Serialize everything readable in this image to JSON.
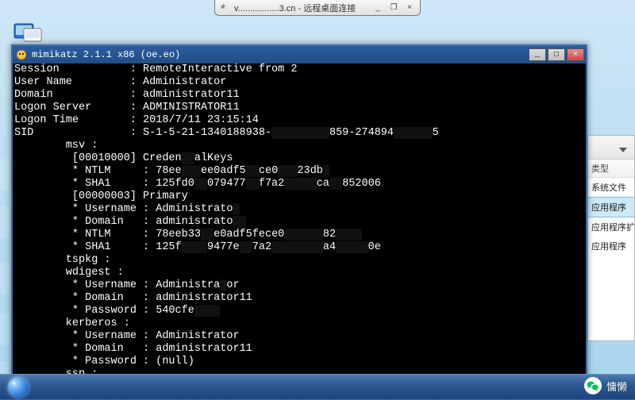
{
  "rdp": {
    "host_partial": "v.................3.cn",
    "suffix": " - 远程桌面连接"
  },
  "console": {
    "title": "mimikatz 2.1.1 x86 (oe.eo)",
    "lines": [
      {
        "t": "Session           : RemoteInteractive from 2"
      },
      {
        "t": "User Name         : Administrator"
      },
      {
        "t": "Domain            : administrator11"
      },
      {
        "t": "Logon Server      : ADMINISTRATOR11"
      },
      {
        "t": "Logon Time        : 2018/7/11 23:15:14"
      },
      {
        "t": "SID               : S-1-5-21-1340188938-",
        "b": "         ",
        "t2": "859-274894",
        "b2": "      ",
        "t3": "5"
      },
      {
        "t": "        msv :"
      },
      {
        "t": "         [00010000] Creden",
        "b": "  ",
        "t2": "alKeys"
      },
      {
        "t": "         * NTLM     : 78ee",
        "b": "   ",
        "t2": "ee0adf5",
        "b2": "  ",
        "t3": "ce0",
        "b3": "   ",
        "t4": "23db",
        "b4": " "
      },
      {
        "t": "         * SHA1     : 125fd0",
        "b": "  ",
        "t2": "079477",
        "b2": "  ",
        "t3": "f7a2",
        "b3": "     ",
        "t4": "ca",
        "b4": "  ",
        "t5": "852006"
      },
      {
        "t": "         [00000003] Primary"
      },
      {
        "t": "         * Username : Administrato",
        "b": " "
      },
      {
        "t": "         * Domain   : administrato",
        "b": "  "
      },
      {
        "t": "         * NTLM     : 78eeb33",
        "b": "  ",
        "t2": "e0adf5fece0",
        "b2": "      ",
        "t3": "82",
        "b3": "    "
      },
      {
        "t": "         * SHA1     : 125f",
        "b": "    ",
        "t2": "9477e",
        "b2": "  ",
        "t3": "7a2",
        "b3": "        ",
        "t4": "a4",
        "b4": "     ",
        "t5": "0e"
      },
      {
        "t": "        tspkg :"
      },
      {
        "t": "        wdigest :"
      },
      {
        "t": "         * Username : Administra",
        "b": " ",
        "t2": "or"
      },
      {
        "t": "         * Domain   : administrator11"
      },
      {
        "t": "         * Password : 540cfe",
        "b": "    "
      },
      {
        "t": "        kerberos :"
      },
      {
        "t": "         * Username : Administrator"
      },
      {
        "t": "         * Domain   : administrator11"
      },
      {
        "t": "         * Password : (null)"
      },
      {
        "t": "        ssp :"
      }
    ],
    "btn_min": "_",
    "btn_max": "□",
    "btn_close": "×"
  },
  "right_panel": {
    "column_header": "类型",
    "rows": [
      {
        "text": "系统文件",
        "sel": false
      },
      {
        "text": "应用程序",
        "sel": true
      },
      {
        "text": "应用程序扩",
        "sel": false
      },
      {
        "text": "应用程序",
        "sel": false
      }
    ]
  },
  "watermark": {
    "text": "慵懒"
  }
}
